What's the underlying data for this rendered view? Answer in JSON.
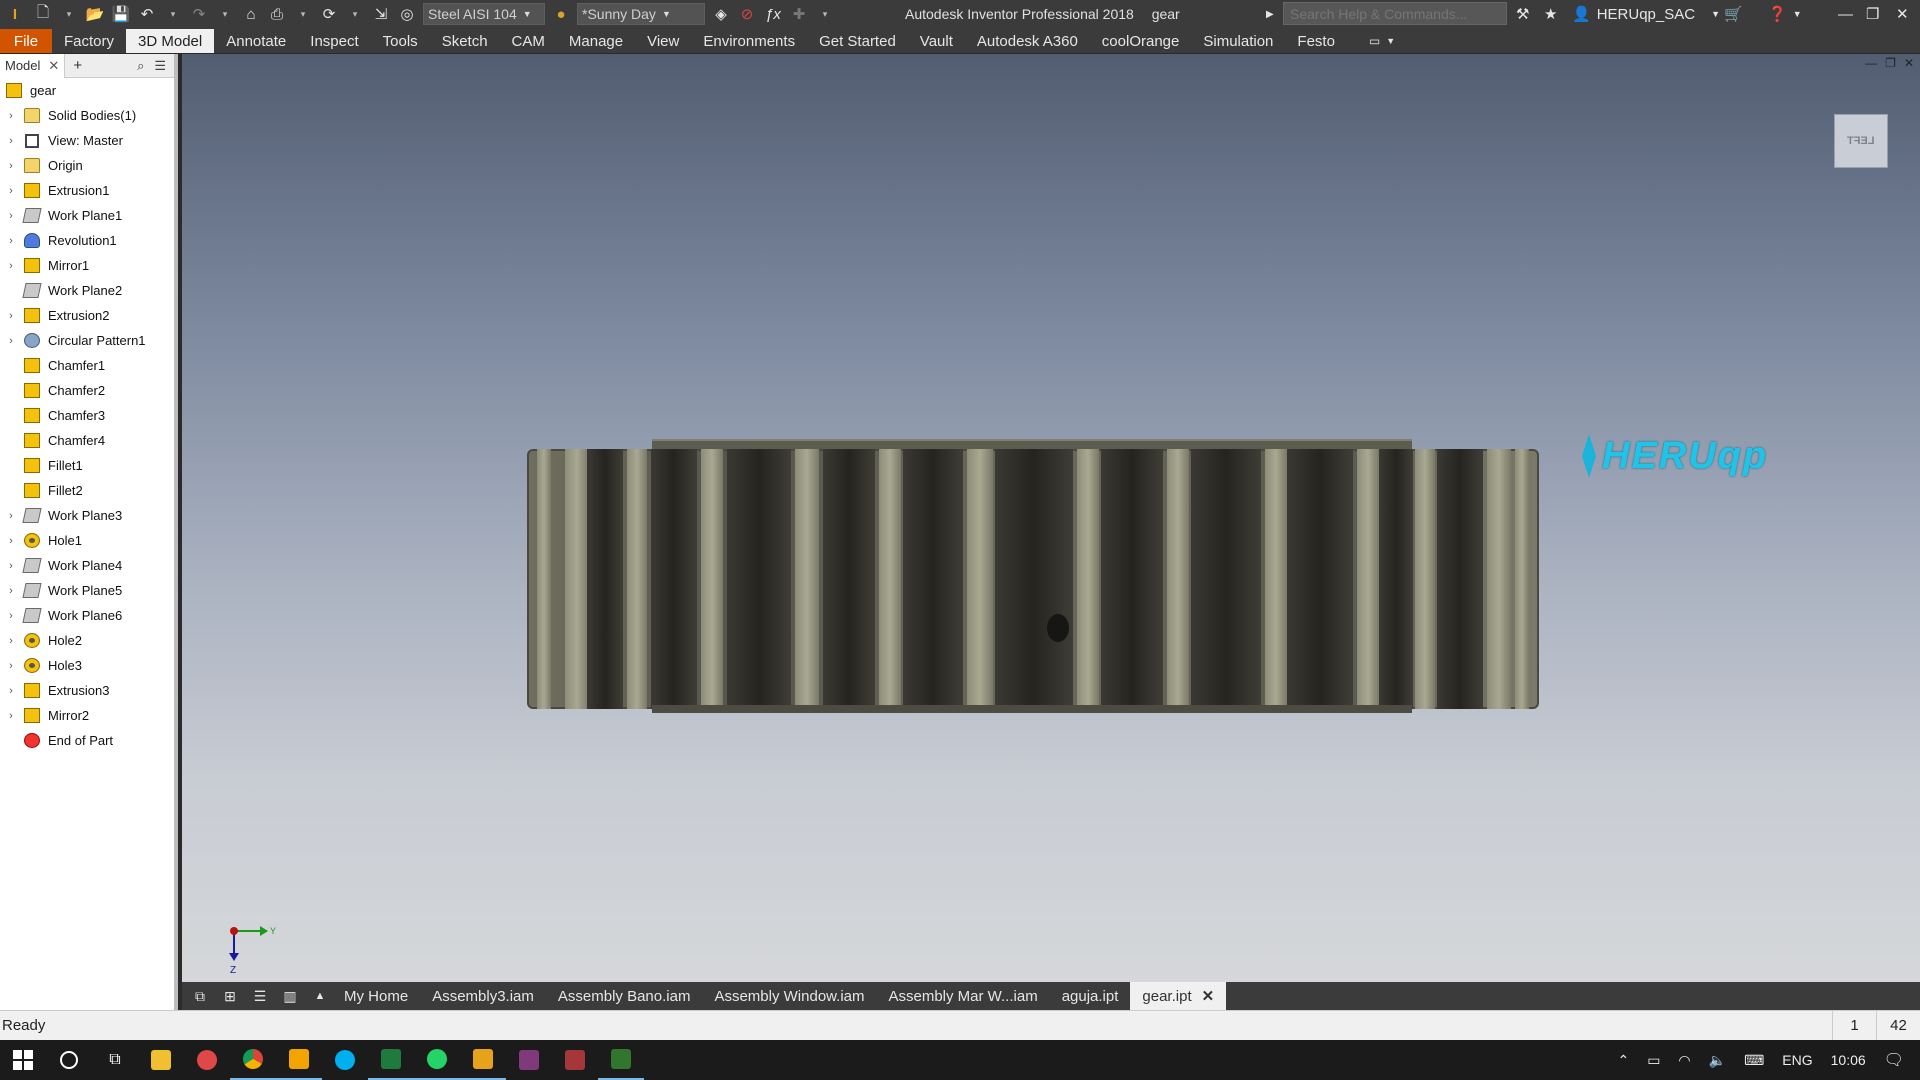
{
  "titlebar": {
    "material": "Steel AISI 104",
    "appearance": "*Sunny Day",
    "app_name": "Autodesk Inventor Professional 2018",
    "document": "gear",
    "search_placeholder": "Search Help & Commands...",
    "user": "HERUqp_SAC"
  },
  "ribbon": {
    "tabs": [
      "File",
      "Factory",
      "3D Model",
      "Annotate",
      "Inspect",
      "Tools",
      "Sketch",
      "CAM",
      "Manage",
      "View",
      "Environments",
      "Get Started",
      "Vault",
      "Autodesk A360",
      "coolOrange",
      "Simulation",
      "Festo"
    ],
    "active": "3D Model"
  },
  "browser": {
    "tab_label": "Model",
    "root": "gear",
    "items": [
      {
        "label": "Solid Bodies(1)",
        "icon": "folder-icon",
        "expand": true
      },
      {
        "label": "View: Master",
        "icon": "view-icon",
        "expand": true
      },
      {
        "label": "Origin",
        "icon": "folder-icon",
        "expand": true
      },
      {
        "label": "Extrusion1",
        "icon": "extrusion-icon",
        "expand": true
      },
      {
        "label": "Work Plane1",
        "icon": "work-plane-icon",
        "expand": true
      },
      {
        "label": "Revolution1",
        "icon": "revolution-icon",
        "expand": true
      },
      {
        "label": "Mirror1",
        "icon": "mirror-icon",
        "expand": true
      },
      {
        "label": "Work Plane2",
        "icon": "work-plane-icon",
        "expand": false
      },
      {
        "label": "Extrusion2",
        "icon": "extrusion-icon",
        "expand": true
      },
      {
        "label": "Circular Pattern1",
        "icon": "circular-pattern-icon",
        "expand": true
      },
      {
        "label": "Chamfer1",
        "icon": "chamfer-icon",
        "expand": false
      },
      {
        "label": "Chamfer2",
        "icon": "chamfer-icon",
        "expand": false
      },
      {
        "label": "Chamfer3",
        "icon": "chamfer-icon",
        "expand": false
      },
      {
        "label": "Chamfer4",
        "icon": "chamfer-icon",
        "expand": false
      },
      {
        "label": "Fillet1",
        "icon": "fillet-icon",
        "expand": false
      },
      {
        "label": "Fillet2",
        "icon": "fillet-icon",
        "expand": false
      },
      {
        "label": "Work Plane3",
        "icon": "work-plane-icon",
        "expand": true
      },
      {
        "label": "Hole1",
        "icon": "hole-icon",
        "expand": true
      },
      {
        "label": "Work Plane4",
        "icon": "work-plane-icon",
        "expand": true
      },
      {
        "label": "Work Plane5",
        "icon": "work-plane-icon",
        "expand": true
      },
      {
        "label": "Work Plane6",
        "icon": "work-plane-icon",
        "expand": true
      },
      {
        "label": "Hole2",
        "icon": "hole-icon",
        "expand": true
      },
      {
        "label": "Hole3",
        "icon": "hole-icon",
        "expand": true
      },
      {
        "label": "Extrusion3",
        "icon": "extrusion-icon",
        "expand": true
      },
      {
        "label": "Mirror2",
        "icon": "mirror-icon",
        "expand": true
      },
      {
        "label": "End of Part",
        "icon": "end-of-part-icon",
        "expand": false
      }
    ]
  },
  "viewport": {
    "viewcube_face": "LEFT",
    "watermark": "HERUqp",
    "triad_y": "Y",
    "triad_z": "Z"
  },
  "doctabs": {
    "tabs": [
      "My Home",
      "Assembly3.iam",
      "Assembly Bano.iam",
      "Assembly Window.iam",
      "Assembly Mar W...iam",
      "aguja.ipt",
      "gear.ipt"
    ],
    "active": "gear.ipt"
  },
  "status": {
    "text": "Ready",
    "count1": "1",
    "count2": "42"
  },
  "taskbar": {
    "lang": "ENG",
    "time": "10:06"
  },
  "colors": {
    "file_tab": "#d35400",
    "watermark": "#21c4e8",
    "gear_body": "#6f6e5e"
  }
}
